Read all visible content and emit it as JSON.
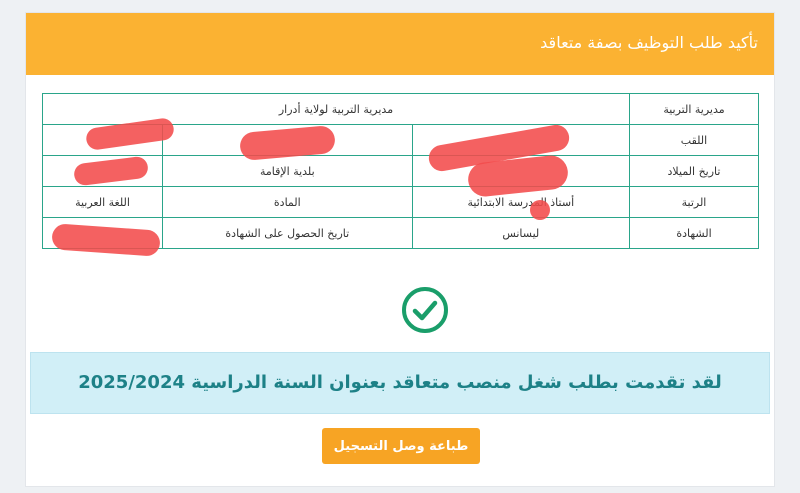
{
  "header": {
    "title": "تأكيد طلب التوظيف بصفة متعاقد"
  },
  "table": {
    "directorate_label": "مديرية التربية",
    "directorate_value": "مديرية التربية لولاية أدرار",
    "surname_label": "اللقب",
    "surname_value": "",
    "first_name_value": "",
    "birth_date_label": "تاريخ الميلاد",
    "birth_date_value": "",
    "residence_label": "بلدية الإقامة",
    "residence_value": "",
    "rank_label": "الرتبة",
    "rank_value": "أستاذ المدرسة الابتدائية",
    "subject_label": "المادة",
    "subject_value": "اللغة العربية",
    "degree_label": "الشهادة",
    "degree_value": "ليسانس",
    "degree_date_label": "تاريخ الحصول على الشهادة",
    "degree_date_value": ""
  },
  "success_message": "لقد تقدمت بطلب شغل منصب متعاقد بعنوان السنة الدراسية 2025/2024",
  "print_button_label": "طباعة وصل التسجيل",
  "icons": {
    "success": "check-circle-icon"
  },
  "colors": {
    "header": "#fbb232",
    "table_border": "#2aa58a",
    "alert_bg": "#d1eff7",
    "alert_text": "#1d8187",
    "button": "#f7a424",
    "check": "#1a9e6a"
  }
}
